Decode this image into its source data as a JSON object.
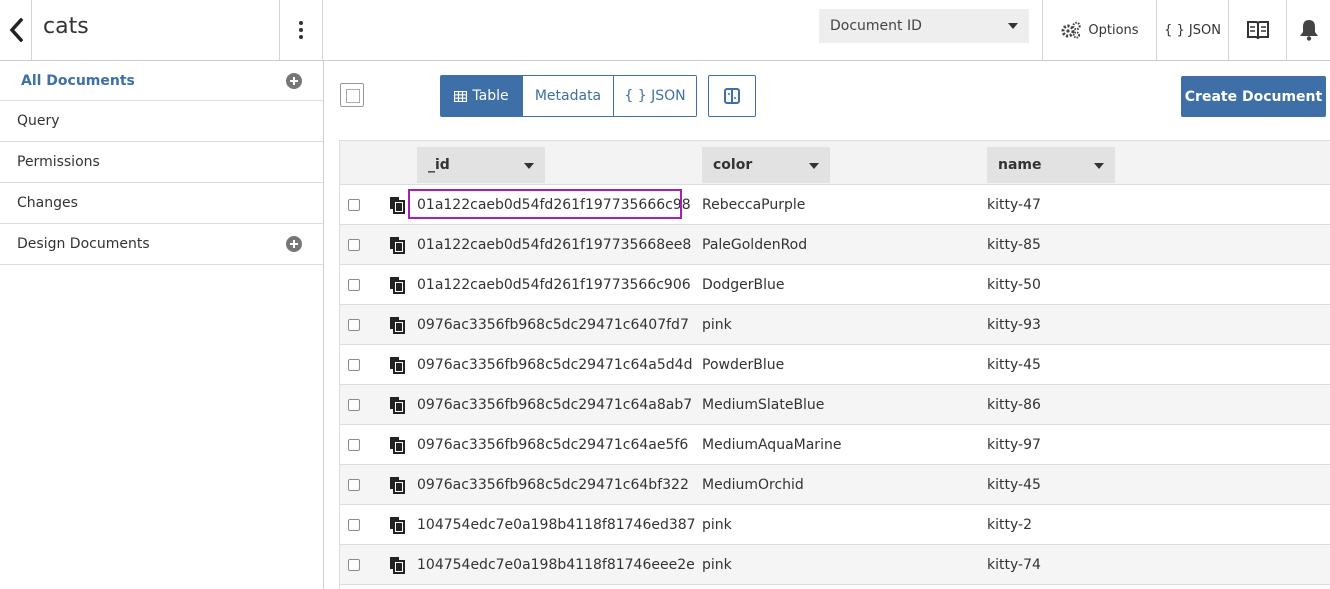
{
  "header": {
    "db_name": "cats",
    "select_value": "Document ID",
    "options_label": "Options",
    "json_label": "{ } JSON"
  },
  "sidebar": {
    "items": [
      {
        "label": "All Documents"
      },
      {
        "label": "Query"
      },
      {
        "label": "Permissions"
      },
      {
        "label": "Changes"
      },
      {
        "label": "Design Documents"
      }
    ]
  },
  "toolbar": {
    "table_label": "Table",
    "metadata_label": "Metadata",
    "json_label": "{ } JSON",
    "create_label": "Create Document"
  },
  "table": {
    "columns": [
      "_id",
      "color",
      "name"
    ],
    "rows": [
      {
        "id": "01a122caeb0d54fd261f197735666c98",
        "color": "RebeccaPurple",
        "name": "kitty-47"
      },
      {
        "id": "01a122caeb0d54fd261f197735668ee8",
        "color": "PaleGoldenRod",
        "name": "kitty-85"
      },
      {
        "id": "01a122caeb0d54fd261f19773566c906",
        "color": "DodgerBlue",
        "name": "kitty-50"
      },
      {
        "id": "0976ac3356fb968c5dc29471c6407fd7",
        "color": "pink",
        "name": "kitty-93"
      },
      {
        "id": "0976ac3356fb968c5dc29471c64a5d4d",
        "color": "PowderBlue",
        "name": "kitty-45"
      },
      {
        "id": "0976ac3356fb968c5dc29471c64a8ab7",
        "color": "MediumSlateBlue",
        "name": "kitty-86"
      },
      {
        "id": "0976ac3356fb968c5dc29471c64ae5f6",
        "color": "MediumAquaMarine",
        "name": "kitty-97"
      },
      {
        "id": "0976ac3356fb968c5dc29471c64bf322",
        "color": "MediumOrchid",
        "name": "kitty-45"
      },
      {
        "id": "104754edc7e0a198b4118f81746ed387",
        "color": "pink",
        "name": "kitty-2"
      },
      {
        "id": "104754edc7e0a198b4118f81746eee2e",
        "color": "pink",
        "name": "kitty-74"
      }
    ]
  },
  "colors": {
    "accent": "#3e6fa6",
    "highlight": "#a61fb6"
  }
}
